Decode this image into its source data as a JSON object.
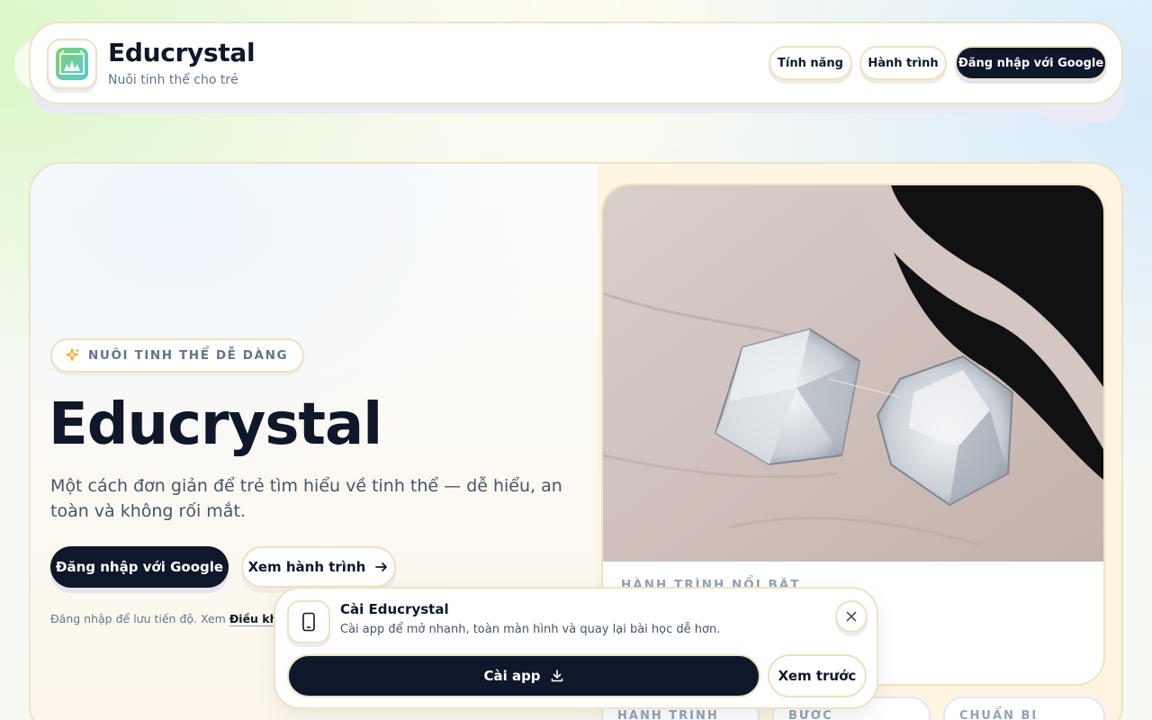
{
  "header": {
    "brand_title": "Educrystal",
    "brand_subtitle": "Nuôi tinh thể cho trẻ",
    "nav": {
      "features": "Tính năng",
      "journeys": "Hành trình",
      "login": "Đăng nhập với Google"
    }
  },
  "hero": {
    "badge": "NUÔI TINH THỂ DỄ DÀNG",
    "title": "Educrystal",
    "description": "Một cách đơn giản để trẻ tìm hiểu về tinh thể — dễ hiểu, an toàn và không rối mắt.",
    "cta_primary": "Đăng nhập với Google",
    "cta_secondary": "Xem hành trình",
    "login_note_prefix": "Đăng nhập để lưu tiến độ. Xem ",
    "login_note_link": "Điều khoản"
  },
  "featured": {
    "label": "HÀNH TRÌNH NỔI BẬT"
  },
  "mini_cards": [
    "HÀNH TRÌNH",
    "BƯỚC",
    "CHUẨN BỊ"
  ],
  "install_toast": {
    "title": "Cài Educrystal",
    "description": "Cài app để mở nhanh, toàn màn hình và quay lại bài học dễ hơn.",
    "install_label": "Cài app",
    "later_label": "Xem trước"
  },
  "colors": {
    "primary_dark": "#0f172a",
    "border_cream": "#ece3c7",
    "muted_text": "#64748b",
    "badge_star": "#f59e0b"
  },
  "icons": {
    "logo": "crystal-logo-icon",
    "badge": "sparkles-icon",
    "cta_secondary": "arrow-right-icon",
    "toast": "smartphone-icon",
    "close": "close-icon",
    "install": "download-icon"
  }
}
